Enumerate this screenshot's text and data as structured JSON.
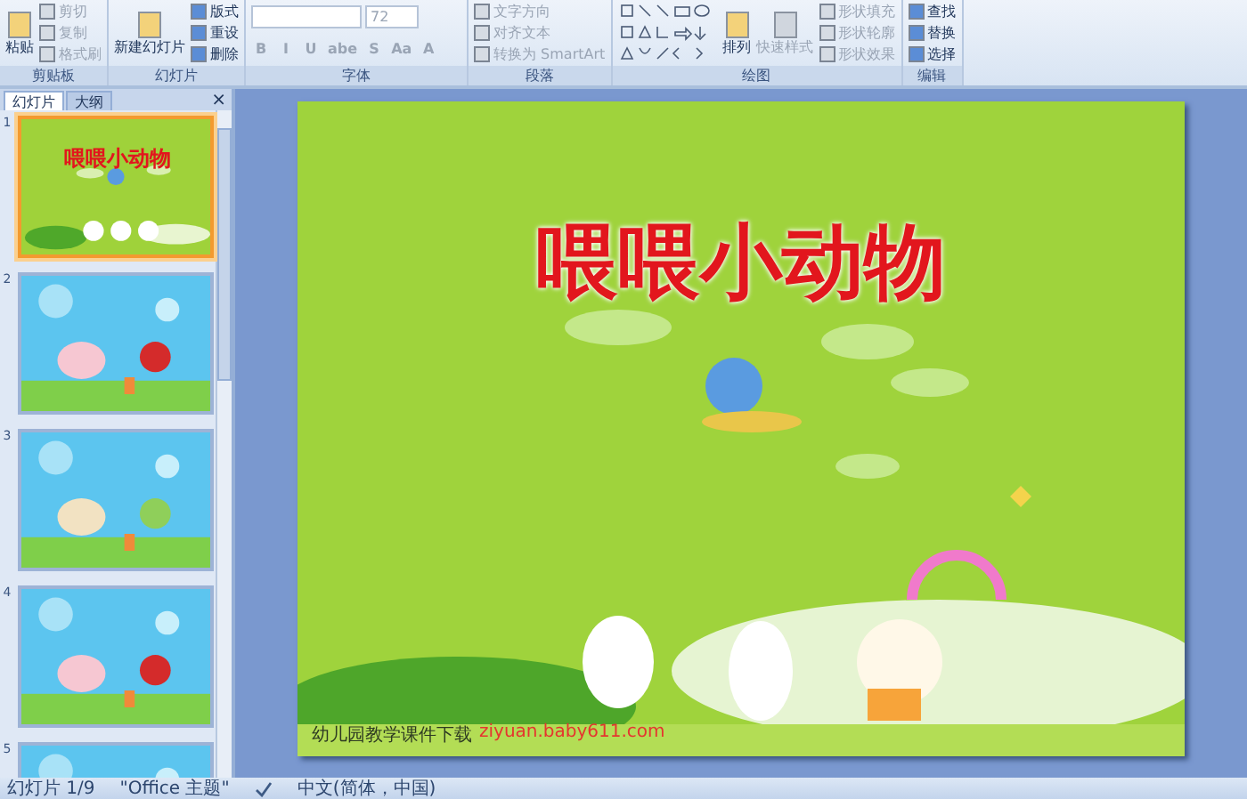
{
  "ribbon": {
    "groups": [
      {
        "label": "剪贴板",
        "controls": [
          {
            "kind": "large",
            "label": "粘贴",
            "disabled": false
          },
          {
            "kind": "small",
            "label": "剪切",
            "disabled": true
          },
          {
            "kind": "small",
            "label": "复制",
            "disabled": true
          },
          {
            "kind": "small",
            "label": "格式刷",
            "disabled": true
          }
        ]
      },
      {
        "label": "幻灯片",
        "controls": [
          {
            "kind": "large",
            "label": "新建幻灯片",
            "disabled": false
          },
          {
            "kind": "small",
            "label": "版式",
            "disabled": false
          },
          {
            "kind": "small",
            "label": "重设",
            "disabled": false
          },
          {
            "kind": "small",
            "label": "删除",
            "disabled": false
          }
        ]
      },
      {
        "label": "字体",
        "controls": [
          {
            "kind": "field",
            "label": "72",
            "disabled": true
          },
          {
            "kind": "format",
            "label": "B",
            "disabled": true
          },
          {
            "kind": "format",
            "label": "I",
            "disabled": true
          },
          {
            "kind": "format",
            "label": "U",
            "disabled": true
          },
          {
            "kind": "format",
            "label": "abe",
            "disabled": true
          },
          {
            "kind": "format",
            "label": "S",
            "disabled": true
          },
          {
            "kind": "format",
            "label": "Aa",
            "disabled": true
          },
          {
            "kind": "format",
            "label": "A",
            "disabled": true
          }
        ]
      },
      {
        "label": "段落",
        "controls": [
          {
            "kind": "small",
            "label": "文字方向",
            "disabled": true
          },
          {
            "kind": "small",
            "label": "对齐文本",
            "disabled": true
          },
          {
            "kind": "small",
            "label": "转换为 SmartArt",
            "disabled": true
          }
        ]
      },
      {
        "label": "绘图",
        "controls": [
          {
            "kind": "gallery",
            "disabled": false
          },
          {
            "kind": "large",
            "label": "排列",
            "disabled": false
          },
          {
            "kind": "large",
            "label": "快速样式",
            "disabled": true
          },
          {
            "kind": "small",
            "label": "形状填充",
            "disabled": true
          },
          {
            "kind": "small",
            "label": "形状轮廓",
            "disabled": true
          },
          {
            "kind": "small",
            "label": "形状效果",
            "disabled": true
          }
        ]
      },
      {
        "label": "编辑",
        "controls": [
          {
            "kind": "small",
            "label": "查找",
            "disabled": false
          },
          {
            "kind": "small",
            "label": "替换",
            "disabled": false
          },
          {
            "kind": "small",
            "label": "选择",
            "disabled": false
          }
        ]
      }
    ]
  },
  "pane": {
    "tabs": [
      {
        "label": "幻灯片",
        "selected": true
      },
      {
        "label": "大纲",
        "selected": false
      }
    ],
    "close": "×",
    "slides": [
      {
        "number": "1",
        "selected": true,
        "title": "喂喂小动物",
        "kind": "title"
      },
      {
        "number": "2",
        "selected": false,
        "kind": "sky"
      },
      {
        "number": "3",
        "selected": false,
        "kind": "sky"
      },
      {
        "number": "4",
        "selected": false,
        "kind": "sky"
      },
      {
        "number": "5",
        "selected": false,
        "kind": "sky"
      }
    ]
  },
  "slide": {
    "title": "喂喂小动物",
    "footer": "幼儿园教学课件下载",
    "footer_link": "ziyuan.baby611.com"
  },
  "status_bar": {
    "slide": "幻灯片 1/9",
    "theme": "\"Office 主题\"",
    "language": "中文(简体，中国)"
  }
}
